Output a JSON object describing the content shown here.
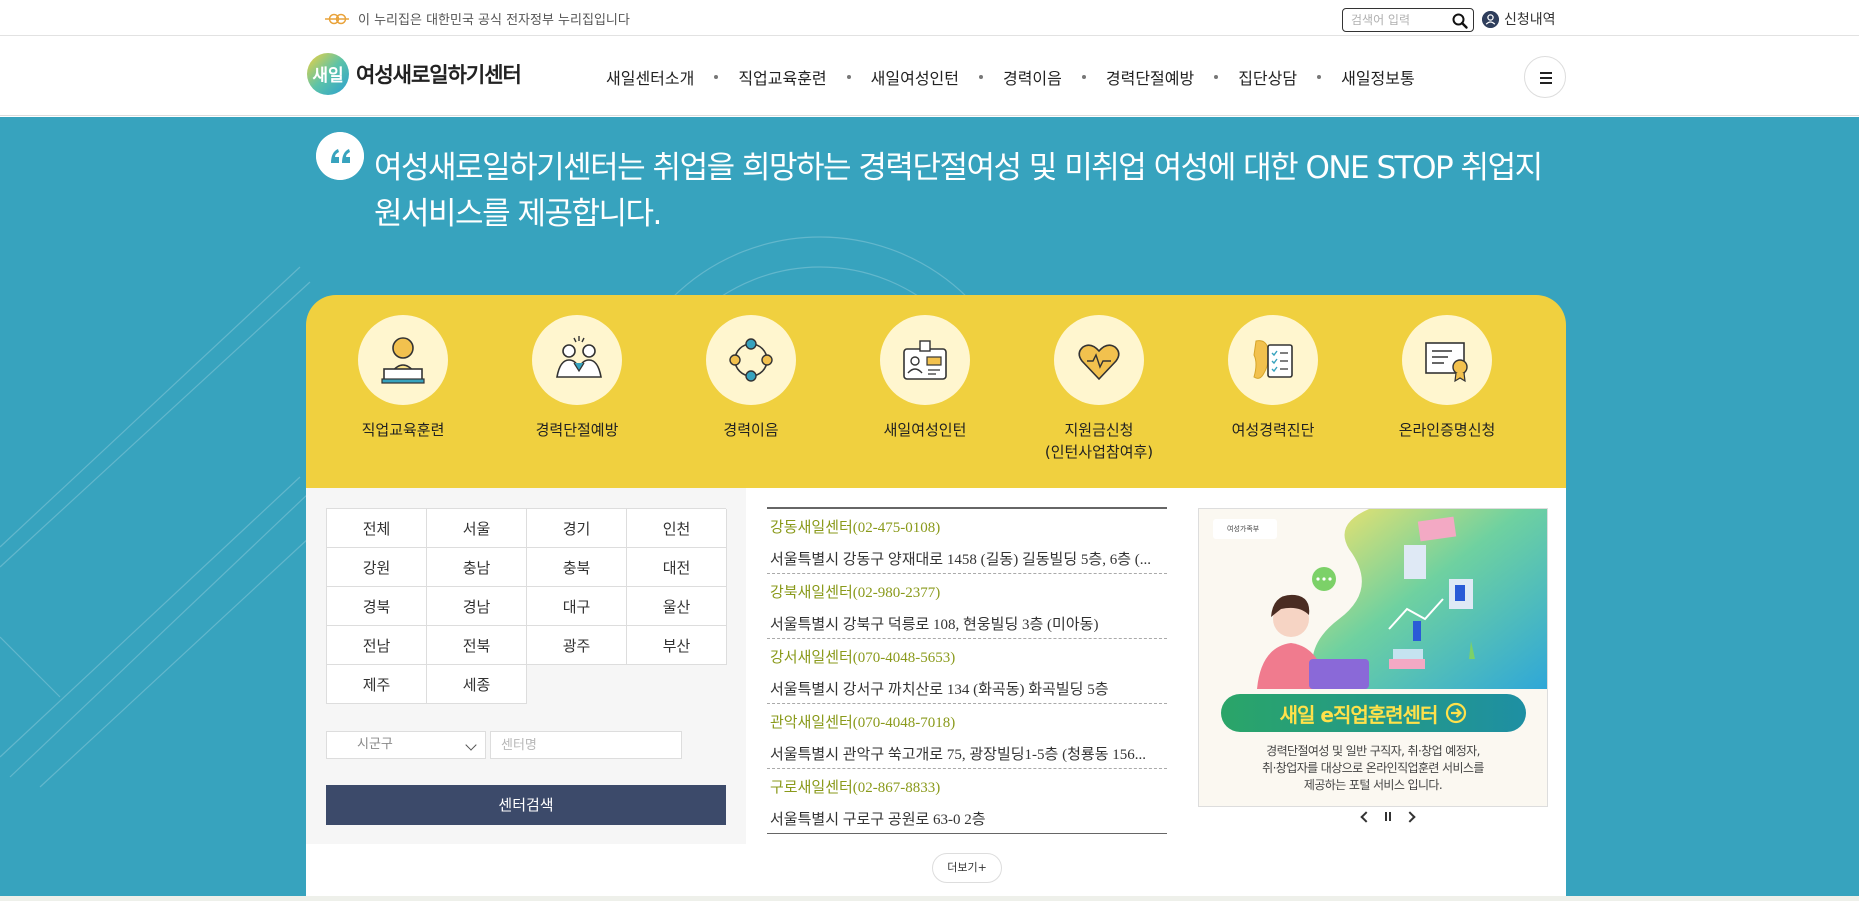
{
  "govbar": {
    "text": "이 누리집은 대한민국 공식 전자정부 누리집입니다",
    "search_placeholder": "검색어 입력",
    "apply_link": "신청내역"
  },
  "header": {
    "logo_mark": "새일",
    "logo_text": "여성새로일하기센터",
    "nav": [
      "새일센터소개",
      "직업교육훈련",
      "새일여성인턴",
      "경력이음",
      "경력단절예방",
      "집단상담",
      "새일정보통"
    ]
  },
  "hero": {
    "text": "여성새로일하기센터는 취업을 희망하는 경력단절여성 및 미취업 여성에 대한 ONE STOP 취업지원서비스를 제공합니다."
  },
  "quick_menu": [
    {
      "label": "직업교육훈련",
      "icon": "teacher-icon"
    },
    {
      "label": "경력단절예방",
      "icon": "people-icon"
    },
    {
      "label": "경력이음",
      "icon": "connect-icon"
    },
    {
      "label": "새일여성인턴",
      "icon": "id-card-icon"
    },
    {
      "label": "지원금신청\n(인턴사업참여후)",
      "icon": "heart-money-icon"
    },
    {
      "label": "여성경력진단",
      "icon": "checklist-icon"
    },
    {
      "label": "온라인증명신청",
      "icon": "certificate-icon"
    }
  ],
  "regions": [
    "전체",
    "서울",
    "경기",
    "인천",
    "강원",
    "충남",
    "충북",
    "대전",
    "경북",
    "경남",
    "대구",
    "울산",
    "전남",
    "전북",
    "광주",
    "부산",
    "제주",
    "세종"
  ],
  "search": {
    "sigungu": "시군구",
    "center_placeholder": "센터명",
    "button": "센터검색"
  },
  "centers": [
    {
      "name": "강동새일센터(02-475-0108)",
      "addr": "서울특별시 강동구 양재대로 1458 (길동) 길동빌딩 5층, 6층 (..."
    },
    {
      "name": "강북새일센터(02-980-2377)",
      "addr": "서울특별시 강북구 덕릉로 108, 현웅빌딩 3층 (미아동)"
    },
    {
      "name": "강서새일센터(070-4048-5653)",
      "addr": "서울특별시 강서구 까치산로 134 (화곡동) 화곡빌딩 5층"
    },
    {
      "name": "관악새일센터(070-4048-7018)",
      "addr": "서울특별시 관악구 쑥고개로 75, 광장빌딩1-5층 (청룡동 156..."
    },
    {
      "name": "구로새일센터(02-867-8833)",
      "addr": "서울특별시 구로구 공원로 63-0 2층"
    }
  ],
  "more_button": "더보기+",
  "banner": {
    "tag": "여성가족부",
    "cta": "새일 e직업훈련센터",
    "desc": "경력단절여성 및 일반 구직자, 취·창업 예정자,\n취·창업자를 대상으로 온라인직업훈련 서비스를\n제공하는 포털 서비스 입니다."
  },
  "colors": {
    "hero_bg": "#37a3be",
    "quick_bg": "#f0d03f",
    "search_btn": "#3c4a6a",
    "center_name": "#8a9a1b"
  }
}
